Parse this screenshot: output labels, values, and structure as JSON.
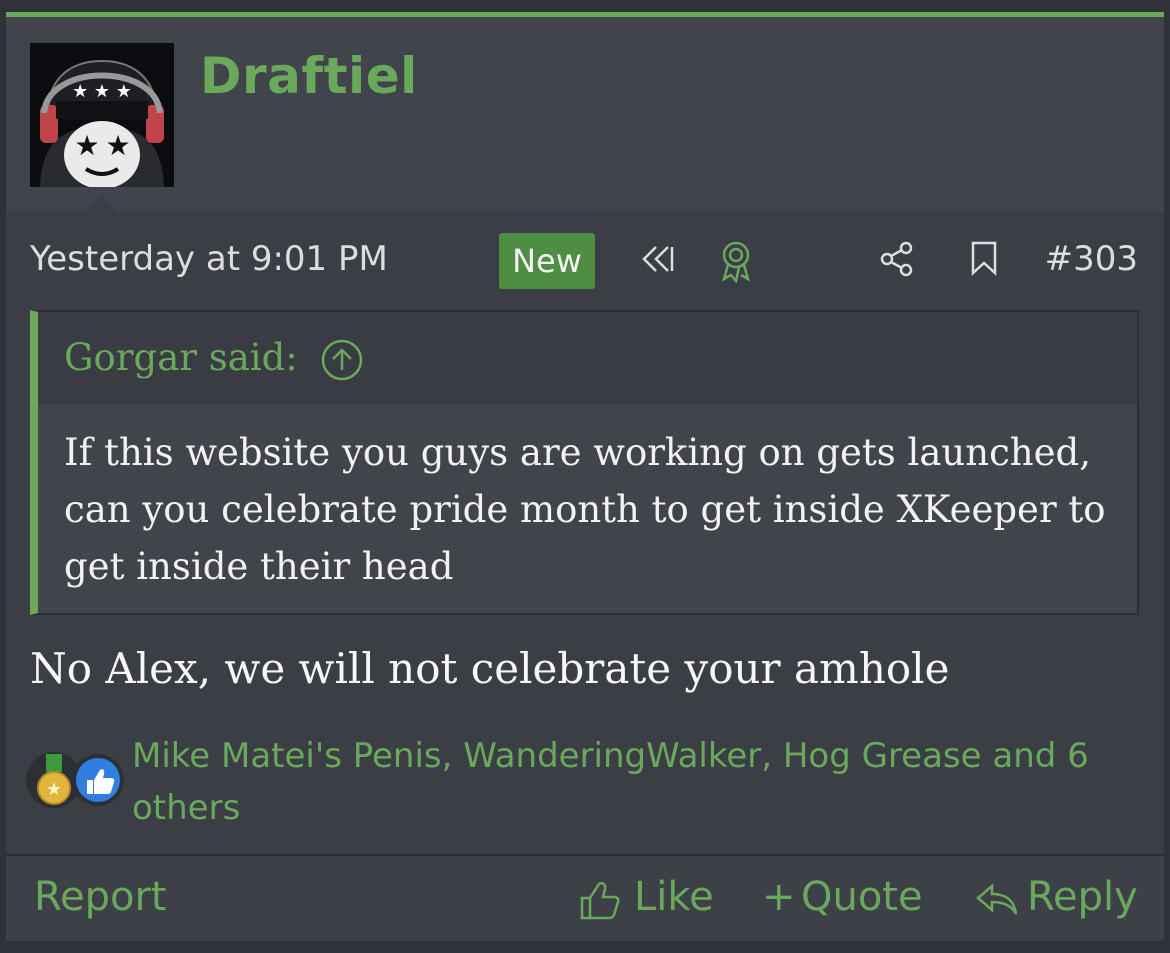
{
  "post": {
    "username": "Draftiel",
    "date": "Yesterday at 9:01 PM",
    "new_badge": "New",
    "post_number": "#303",
    "icons": [
      "rewind-icon",
      "award-ribbon-icon",
      "share-icon",
      "bookmark-icon"
    ]
  },
  "quote": {
    "author": "Gorgar said:",
    "text": "If this website you guys are working on gets launched, can you celebrate pride month to get inside XKeeper to get inside their head"
  },
  "message": "No Alex, we will not celebrate your amhole",
  "reactions": {
    "icons": [
      "medal-icon",
      "thumbs-up-icon"
    ],
    "text": "Mike Matei's Penis, WanderingWalker, Hog Grease and 6 others"
  },
  "actions": {
    "report": "Report",
    "like": "Like",
    "quote": "Quote",
    "reply": "Reply"
  },
  "colors": {
    "accent": "#6aa85c",
    "background": "#3b3e45"
  }
}
